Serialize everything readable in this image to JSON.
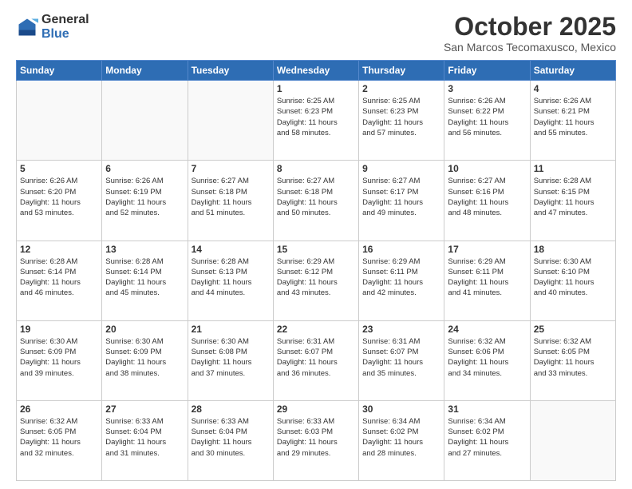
{
  "header": {
    "logo_general": "General",
    "logo_blue": "Blue",
    "month_title": "October 2025",
    "location": "San Marcos Tecomaxusco, Mexico"
  },
  "weekdays": [
    "Sunday",
    "Monday",
    "Tuesday",
    "Wednesday",
    "Thursday",
    "Friday",
    "Saturday"
  ],
  "weeks": [
    [
      {
        "day": "",
        "info": ""
      },
      {
        "day": "",
        "info": ""
      },
      {
        "day": "",
        "info": ""
      },
      {
        "day": "1",
        "info": "Sunrise: 6:25 AM\nSunset: 6:23 PM\nDaylight: 11 hours\nand 58 minutes."
      },
      {
        "day": "2",
        "info": "Sunrise: 6:25 AM\nSunset: 6:23 PM\nDaylight: 11 hours\nand 57 minutes."
      },
      {
        "day": "3",
        "info": "Sunrise: 6:26 AM\nSunset: 6:22 PM\nDaylight: 11 hours\nand 56 minutes."
      },
      {
        "day": "4",
        "info": "Sunrise: 6:26 AM\nSunset: 6:21 PM\nDaylight: 11 hours\nand 55 minutes."
      }
    ],
    [
      {
        "day": "5",
        "info": "Sunrise: 6:26 AM\nSunset: 6:20 PM\nDaylight: 11 hours\nand 53 minutes."
      },
      {
        "day": "6",
        "info": "Sunrise: 6:26 AM\nSunset: 6:19 PM\nDaylight: 11 hours\nand 52 minutes."
      },
      {
        "day": "7",
        "info": "Sunrise: 6:27 AM\nSunset: 6:18 PM\nDaylight: 11 hours\nand 51 minutes."
      },
      {
        "day": "8",
        "info": "Sunrise: 6:27 AM\nSunset: 6:18 PM\nDaylight: 11 hours\nand 50 minutes."
      },
      {
        "day": "9",
        "info": "Sunrise: 6:27 AM\nSunset: 6:17 PM\nDaylight: 11 hours\nand 49 minutes."
      },
      {
        "day": "10",
        "info": "Sunrise: 6:27 AM\nSunset: 6:16 PM\nDaylight: 11 hours\nand 48 minutes."
      },
      {
        "day": "11",
        "info": "Sunrise: 6:28 AM\nSunset: 6:15 PM\nDaylight: 11 hours\nand 47 minutes."
      }
    ],
    [
      {
        "day": "12",
        "info": "Sunrise: 6:28 AM\nSunset: 6:14 PM\nDaylight: 11 hours\nand 46 minutes."
      },
      {
        "day": "13",
        "info": "Sunrise: 6:28 AM\nSunset: 6:14 PM\nDaylight: 11 hours\nand 45 minutes."
      },
      {
        "day": "14",
        "info": "Sunrise: 6:28 AM\nSunset: 6:13 PM\nDaylight: 11 hours\nand 44 minutes."
      },
      {
        "day": "15",
        "info": "Sunrise: 6:29 AM\nSunset: 6:12 PM\nDaylight: 11 hours\nand 43 minutes."
      },
      {
        "day": "16",
        "info": "Sunrise: 6:29 AM\nSunset: 6:11 PM\nDaylight: 11 hours\nand 42 minutes."
      },
      {
        "day": "17",
        "info": "Sunrise: 6:29 AM\nSunset: 6:11 PM\nDaylight: 11 hours\nand 41 minutes."
      },
      {
        "day": "18",
        "info": "Sunrise: 6:30 AM\nSunset: 6:10 PM\nDaylight: 11 hours\nand 40 minutes."
      }
    ],
    [
      {
        "day": "19",
        "info": "Sunrise: 6:30 AM\nSunset: 6:09 PM\nDaylight: 11 hours\nand 39 minutes."
      },
      {
        "day": "20",
        "info": "Sunrise: 6:30 AM\nSunset: 6:09 PM\nDaylight: 11 hours\nand 38 minutes."
      },
      {
        "day": "21",
        "info": "Sunrise: 6:30 AM\nSunset: 6:08 PM\nDaylight: 11 hours\nand 37 minutes."
      },
      {
        "day": "22",
        "info": "Sunrise: 6:31 AM\nSunset: 6:07 PM\nDaylight: 11 hours\nand 36 minutes."
      },
      {
        "day": "23",
        "info": "Sunrise: 6:31 AM\nSunset: 6:07 PM\nDaylight: 11 hours\nand 35 minutes."
      },
      {
        "day": "24",
        "info": "Sunrise: 6:32 AM\nSunset: 6:06 PM\nDaylight: 11 hours\nand 34 minutes."
      },
      {
        "day": "25",
        "info": "Sunrise: 6:32 AM\nSunset: 6:05 PM\nDaylight: 11 hours\nand 33 minutes."
      }
    ],
    [
      {
        "day": "26",
        "info": "Sunrise: 6:32 AM\nSunset: 6:05 PM\nDaylight: 11 hours\nand 32 minutes."
      },
      {
        "day": "27",
        "info": "Sunrise: 6:33 AM\nSunset: 6:04 PM\nDaylight: 11 hours\nand 31 minutes."
      },
      {
        "day": "28",
        "info": "Sunrise: 6:33 AM\nSunset: 6:04 PM\nDaylight: 11 hours\nand 30 minutes."
      },
      {
        "day": "29",
        "info": "Sunrise: 6:33 AM\nSunset: 6:03 PM\nDaylight: 11 hours\nand 29 minutes."
      },
      {
        "day": "30",
        "info": "Sunrise: 6:34 AM\nSunset: 6:02 PM\nDaylight: 11 hours\nand 28 minutes."
      },
      {
        "day": "31",
        "info": "Sunrise: 6:34 AM\nSunset: 6:02 PM\nDaylight: 11 hours\nand 27 minutes."
      },
      {
        "day": "",
        "info": ""
      }
    ]
  ]
}
